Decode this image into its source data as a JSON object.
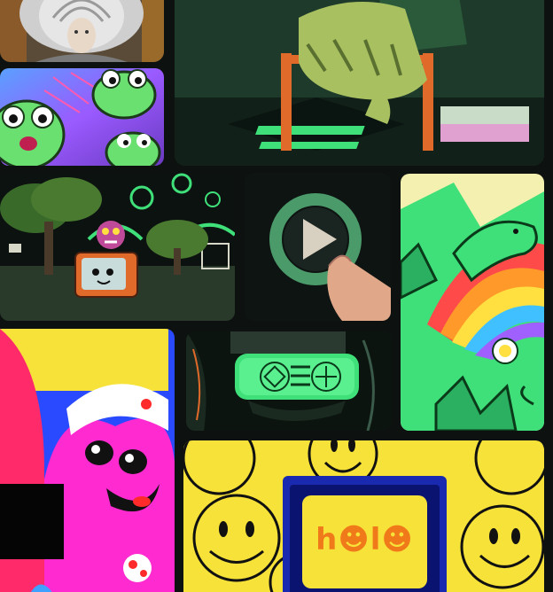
{
  "gallery": {
    "tiles": [
      {
        "id": "portrait",
        "icon": "cowboy-portrait"
      },
      {
        "id": "hands-on-handle",
        "icon": "hand-grip"
      },
      {
        "id": "frogs",
        "icon": "frog-character"
      },
      {
        "id": "night-forest",
        "icon": "tv-creature"
      },
      {
        "id": "play-button",
        "icon": "play-icon"
      },
      {
        "id": "rainbow-dolphin",
        "icon": "dolphin-rainbow"
      },
      {
        "id": "pink-blob",
        "icon": "blob-character"
      },
      {
        "id": "vr-headset",
        "icon": "vr-headset"
      },
      {
        "id": "holo-smileys",
        "icon": "smiley-tv"
      }
    ],
    "brand": {
      "logo_text": "h☻l☻"
    },
    "colors": {
      "accent_green": "#3fe07a",
      "yellow": "#f7e23a",
      "background": "#0d1110",
      "orange": "#f07a1a"
    }
  }
}
